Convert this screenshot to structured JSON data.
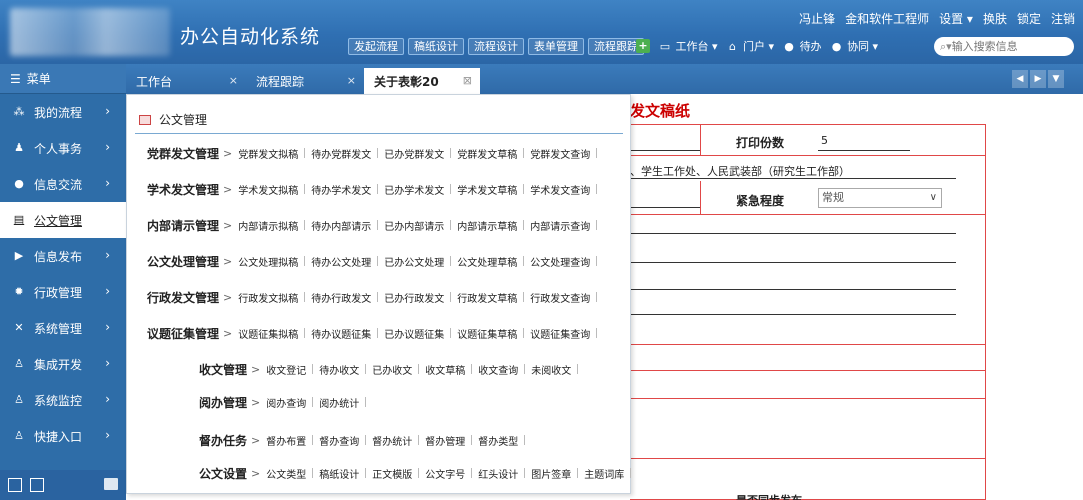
{
  "header": {
    "title": "办公自动化系统",
    "user_links": [
      "冯止锋",
      "金和软件工程师",
      "设置 ▾",
      "换肤",
      "锁定",
      "注销"
    ],
    "quick_buttons": [
      "发起流程",
      "稿纸设计",
      "流程设计",
      "表单管理",
      "流程跟踪"
    ],
    "tools": {
      "workbench": "工作台",
      "portal": "门户",
      "todo": "待办",
      "notify": "协同"
    },
    "search_placeholder": "输入搜索信息"
  },
  "sidebar": {
    "menu_label": "菜单",
    "items": [
      {
        "label": "我的流程",
        "icon": "flow-icon"
      },
      {
        "label": "个人事务",
        "icon": "person-icon"
      },
      {
        "label": "信息交流",
        "icon": "chat-icon"
      },
      {
        "label": "公文管理",
        "icon": "document-icon"
      },
      {
        "label": "信息发布",
        "icon": "publish-icon"
      },
      {
        "label": "行政管理",
        "icon": "admin-icon"
      },
      {
        "label": "系统管理",
        "icon": "wrench-icon"
      },
      {
        "label": "集成开发",
        "icon": "integration-icon"
      },
      {
        "label": "系统监控",
        "icon": "monitor-icon"
      },
      {
        "label": "快捷入口",
        "icon": "shortcut-icon"
      }
    ]
  },
  "tabs": [
    {
      "label": "工作台",
      "close": "×"
    },
    {
      "label": "流程跟踪",
      "close": "×"
    },
    {
      "label": "关于表彰20",
      "close": "⊠"
    }
  ],
  "panel": {
    "title": "公文管理",
    "rows": [
      {
        "title": "党群发文管理",
        "links": [
          "党群发文拟稿",
          "待办党群发文",
          "已办党群发文",
          "党群发文草稿",
          "党群发文查询"
        ]
      },
      {
        "title": "学术发文管理",
        "links": [
          "学术发文拟稿",
          "待办学术发文",
          "已办学术发文",
          "学术发文草稿",
          "学术发文查询"
        ]
      },
      {
        "title": "内部请示管理",
        "links": [
          "内部请示拟稿",
          "待办内部请示",
          "已办内部请示",
          "内部请示草稿",
          "内部请示查询"
        ]
      },
      {
        "title": "公文处理管理",
        "links": [
          "公文处理拟稿",
          "待办公文处理",
          "已办公文处理",
          "公文处理草稿",
          "公文处理查询"
        ]
      },
      {
        "title": "行政发文管理",
        "links": [
          "行政发文拟稿",
          "待办行政发文",
          "已办行政发文",
          "行政发文草稿",
          "行政发文查询"
        ]
      },
      {
        "title": "议题征集管理",
        "links": [
          "议题征集拟稿",
          "待办议题征集",
          "已办议题征集",
          "议题征集草稿",
          "议题征集查询"
        ]
      },
      {
        "title": "收文管理",
        "links": [
          "收文登记",
          "待办收文",
          "已办收文",
          "收文草稿",
          "收文查询",
          "未阅收文"
        ]
      },
      {
        "title": "阅办管理",
        "links": [
          "阅办查询",
          "阅办统计"
        ]
      },
      {
        "title": "督办任务",
        "links": [
          "督办布置",
          "督办查询",
          "督办统计",
          "督办管理",
          "督办类型"
        ]
      },
      {
        "title": "公文设置",
        "links": [
          "公文类型",
          "稿纸设计",
          "正文模版",
          "公文字号",
          "红头设计",
          "图片签章",
          "主题词库"
        ]
      }
    ]
  },
  "form": {
    "title": "发文稿纸",
    "print_copies_label": "打印份数",
    "print_copies_value": "5",
    "recipients": "、学生工作处、人民武装部（研究生工作部）",
    "urgency_label": "紧急程度",
    "urgency_value": "常规",
    "bottom_label": "是否同步发布"
  }
}
